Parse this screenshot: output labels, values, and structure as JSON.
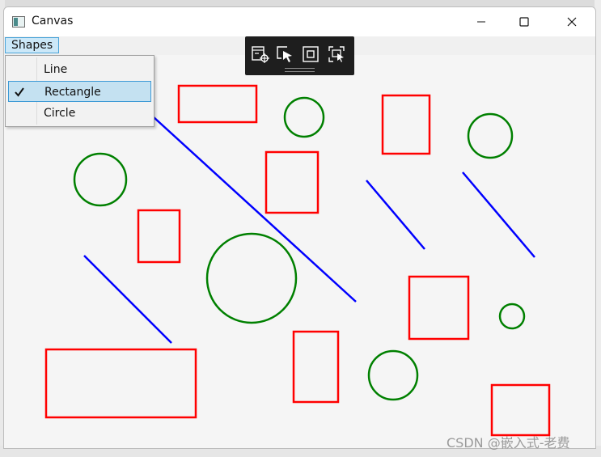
{
  "window": {
    "title": "Canvas"
  },
  "menu": {
    "label": "Shapes",
    "items": [
      {
        "label": "Line",
        "checked": false
      },
      {
        "label": "Rectangle",
        "checked": true
      },
      {
        "label": "Circle",
        "checked": false
      }
    ]
  },
  "colors": {
    "line": "#0000ff",
    "rectangle": "#ff0000",
    "circle": "#008000"
  },
  "watermark": "CSDN @嵌入式-老费"
}
